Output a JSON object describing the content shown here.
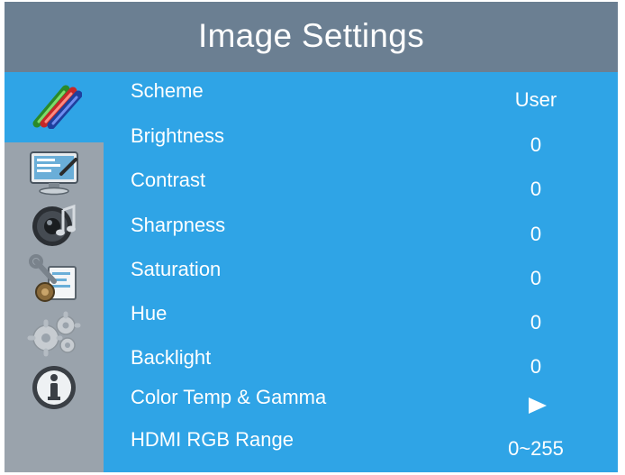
{
  "header": {
    "title": "Image Settings"
  },
  "sidebar": {
    "items": [
      {
        "icon": "picture-pencils-icon",
        "selected": true
      },
      {
        "icon": "monitor-display-icon",
        "selected": false
      },
      {
        "icon": "speaker-audio-icon",
        "selected": false
      },
      {
        "icon": "tools-settings-icon",
        "selected": false
      },
      {
        "icon": "gears-icon",
        "selected": false
      },
      {
        "icon": "info-icon",
        "selected": false
      }
    ]
  },
  "menu": {
    "items": [
      {
        "label": "Scheme",
        "value": "User"
      },
      {
        "label": "Brightness",
        "value": "0"
      },
      {
        "label": "Contrast",
        "value": "0"
      },
      {
        "label": "Sharpness",
        "value": "0"
      },
      {
        "label": "Saturation",
        "value": "0"
      },
      {
        "label": "Hue",
        "value": "0"
      },
      {
        "label": "Backlight",
        "value": "0"
      },
      {
        "label": "Color Temp & Gamma",
        "value": "",
        "submenu_icon": "play-arrow-icon"
      },
      {
        "label": "HDMI RGB Range",
        "value": "0~255"
      }
    ]
  },
  "colors": {
    "panel_blue": "#2fa4e6",
    "title_gray": "#6b7f92",
    "sidebar_gray": "#9aa3ac",
    "text": "#ffffff"
  }
}
